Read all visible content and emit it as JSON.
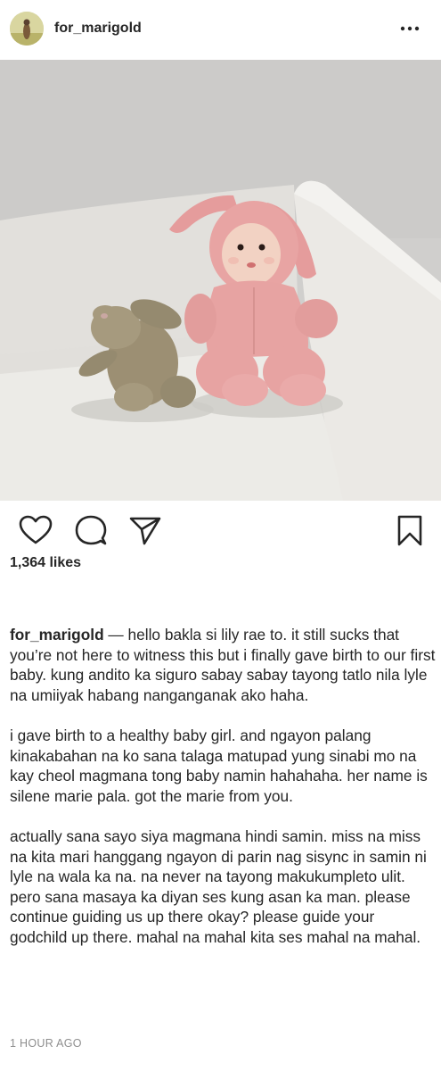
{
  "post": {
    "username": "for_marigold",
    "likes": "1,364 likes",
    "caption": {
      "username": "for_marigold",
      "separator": " — ",
      "paragraphs": [
        "hello bakla si lily rae to. it still sucks that you’re not here to witness this but i finally gave birth to our first baby. kung andito ka siguro sabay sabay tayong tatlo nila lyle na umiiyak habang nanganganak ako haha.",
        "i gave birth to a healthy baby girl. and ngayon palang kinakabahan na ko sana talaga matupad yung sinabi mo na kay cheol magmana tong baby namin hahahaha. her name is silene marie pala. got the marie from you.",
        "actually sana sayo siya magmana hindi samin. miss na miss na kita mari hanggang ngayon di parin nag sisync in samin ni lyle na wala ka na. na never na tayong makukumpleto ulit. pero sana masaya ka diyan ses kung asan ka man. please continue guiding us up there okay? please guide your godchild up there. mahal na mahal kita ses mahal na mahal."
      ]
    },
    "timestamp": "1 HOUR AGO"
  },
  "icons": {
    "more": "more-options-icon",
    "like": "heart-icon",
    "comment": "comment-icon",
    "share": "paper-plane-icon",
    "save": "bookmark-icon"
  },
  "colors": {
    "text": "#262626",
    "muted": "#8e8e8e",
    "sofa": "#e9e7e3",
    "wall": "#cfcecc",
    "suit": "#e7a3a2",
    "plush": "#9c8f73"
  }
}
